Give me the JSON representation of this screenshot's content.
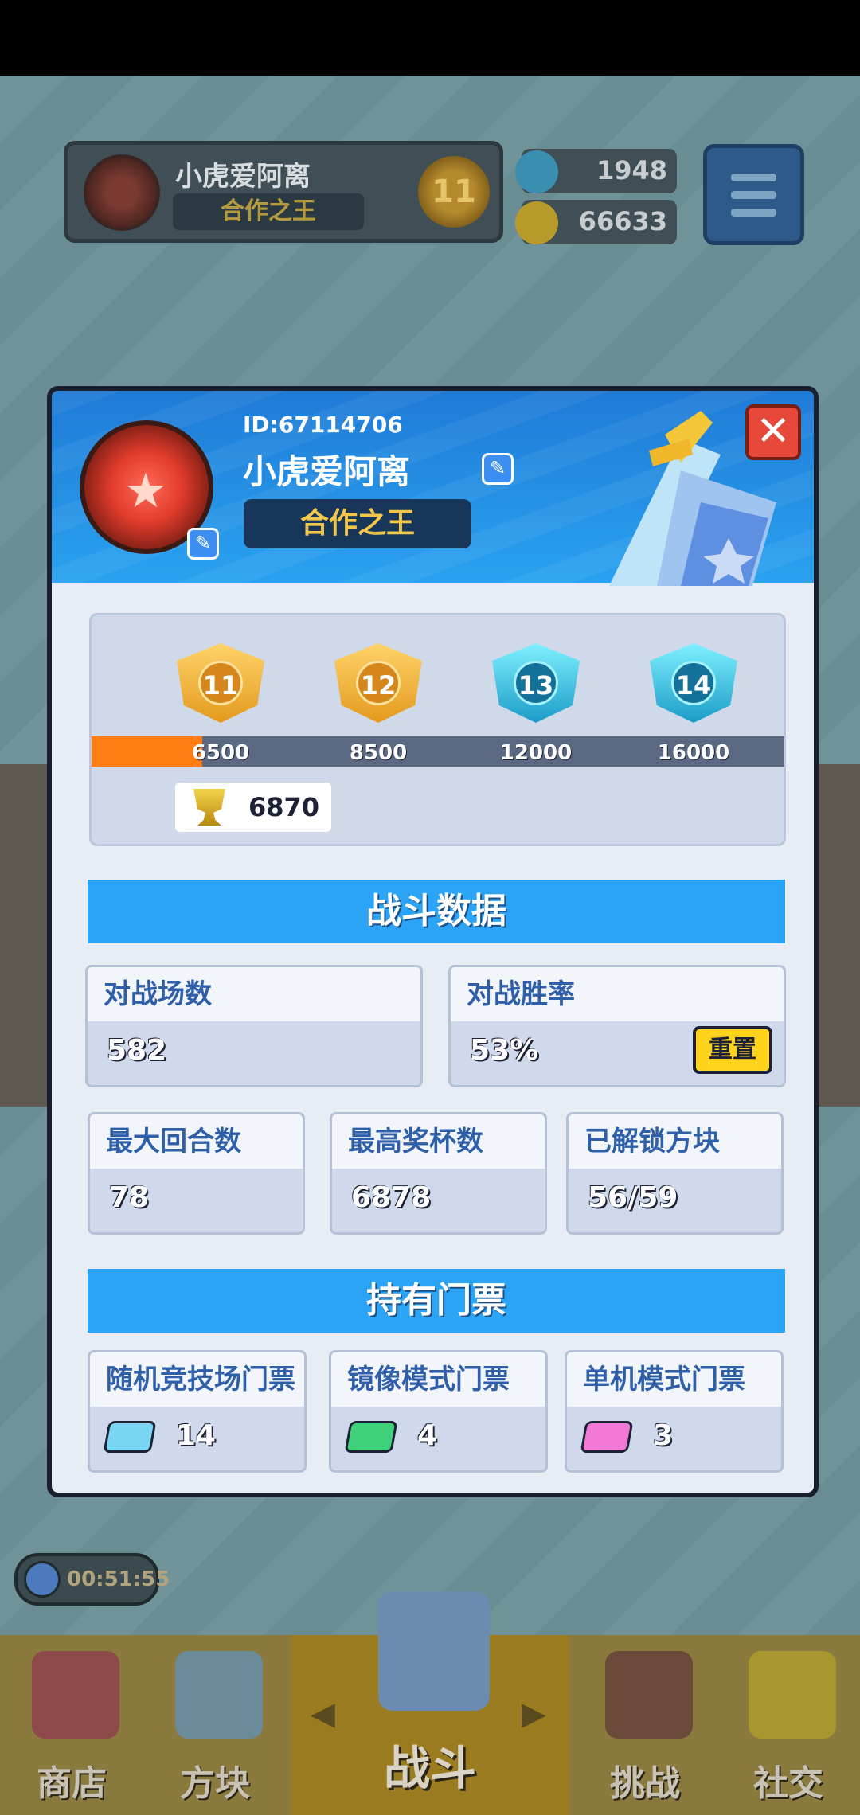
{
  "header": {
    "player_name": "小虎爱阿离",
    "player_title": "合作之王",
    "rank_level": "11",
    "gems": "1948",
    "coins": "66633"
  },
  "profile": {
    "id_label": "ID:67114706",
    "name": "小虎爱阿离",
    "title": "合作之王",
    "close_label": "✕"
  },
  "rank_track": {
    "tiers": [
      {
        "level": "11",
        "threshold": "6500"
      },
      {
        "level": "12",
        "threshold": "8500"
      },
      {
        "level": "13",
        "threshold": "12000"
      },
      {
        "level": "14",
        "threshold": "16000"
      }
    ],
    "current_trophies": "6870",
    "progress_fraction": 0.16
  },
  "battle_data": {
    "heading": "战斗数据",
    "matches_label": "对战场数",
    "matches_value": "582",
    "winrate_label": "对战胜率",
    "winrate_value": "53%",
    "reset_label": "重置",
    "max_rounds_label": "最大回合数",
    "max_rounds_value": "78",
    "max_trophies_label": "最高奖杯数",
    "max_trophies_value": "6878",
    "blocks_label": "已解锁方块",
    "blocks_value": "56/59"
  },
  "tickets": {
    "heading": "持有门票",
    "items": [
      {
        "label": "随机竞技场门票",
        "count": "14",
        "color": "#7ad6f2"
      },
      {
        "label": "镜像模式门票",
        "count": "4",
        "color": "#3fd27a"
      },
      {
        "label": "单机模式门票",
        "count": "3",
        "color": "#f07ad6"
      }
    ]
  },
  "timer": "00:51:55",
  "nav": {
    "shop": "商店",
    "blocks": "方块",
    "battle": "战斗",
    "challenge": "挑战",
    "social": "社交"
  }
}
